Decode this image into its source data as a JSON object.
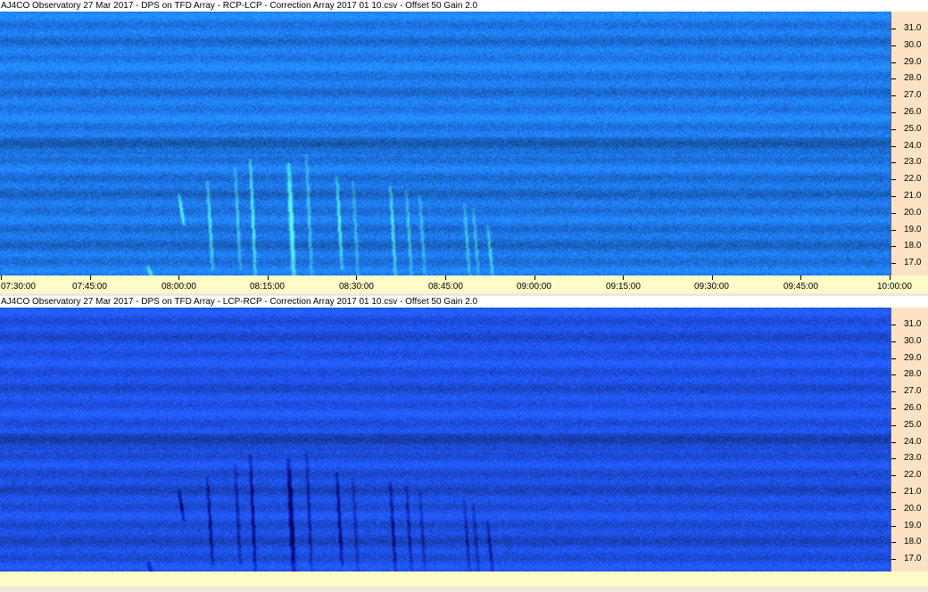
{
  "panels": [
    {
      "title": "AJ4CO Observatory 27 Mar 2017  -  DPS on TFD Array  -  RCP-LCP  -  Correction Array 2017 01 10.csv  -  Offset 50  Gain 2.0",
      "base_color": "#1f7af0",
      "bursts": "bright"
    },
    {
      "title": "AJ4CO Observatory 27 Mar 2017  -  DPS on TFD Array  -  LCP-RCP  -  Correction Array 2017 01 10.csv  -  Offset 50  Gain 2.0",
      "base_color": "#1f52ea",
      "bursts": "dark"
    }
  ],
  "freq_axis": {
    "labels": [
      "31.0",
      "30.0",
      "29.0",
      "28.0",
      "27.0",
      "26.0",
      "25.0",
      "24.0",
      "23.0",
      "22.0",
      "21.0",
      "20.0",
      "19.0",
      "18.0",
      "17.0"
    ]
  },
  "time_axis": {
    "labels": [
      "07:30:00",
      "07:45:00",
      "08:00:00",
      "08:15:00",
      "08:30:00",
      "08:45:00",
      "09:00:00",
      "09:15:00",
      "09:30:00",
      "09:45:00",
      "10:00:00"
    ]
  }
}
